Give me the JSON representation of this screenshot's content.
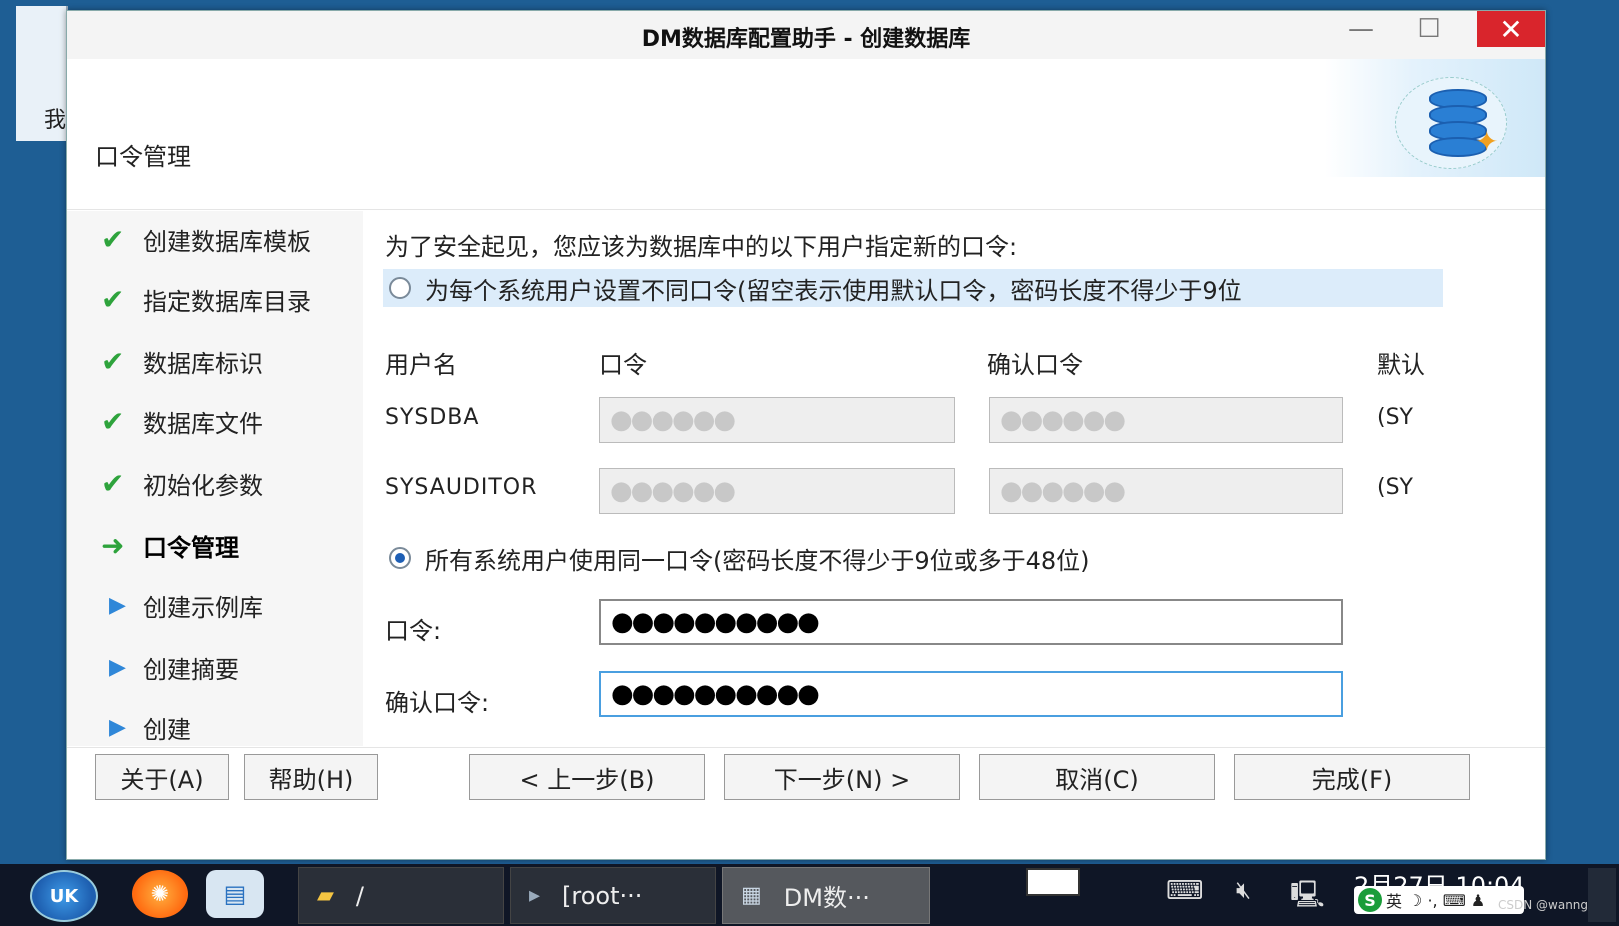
{
  "desktop": {
    "icon_text": "我"
  },
  "window": {
    "title": "DM数据库配置助手 - 创建数据库",
    "minimize": "—",
    "maximize": "☐",
    "close": "✕"
  },
  "header": {
    "section_title": "口令管理"
  },
  "nav": {
    "items": [
      {
        "label": "创建数据库模板",
        "status": "✔"
      },
      {
        "label": "指定数据库目录",
        "status": "✔"
      },
      {
        "label": "数据库标识",
        "status": "✔"
      },
      {
        "label": "数据库文件",
        "status": "✔"
      },
      {
        "label": "初始化参数",
        "status": "✔"
      },
      {
        "label": "口令管理",
        "status": "➜"
      },
      {
        "label": "创建示例库",
        "status": "▶"
      },
      {
        "label": "创建摘要",
        "status": "▶"
      },
      {
        "label": "创建",
        "status": "▶"
      }
    ]
  },
  "content": {
    "intro": "为了安全起见，您应该为数据库中的以下用户指定新的口令:",
    "option_individual": "为每个系统用户设置不同口令(留空表示使用默认口令，密码长度不得少于9位",
    "columns": {
      "username": "用户名",
      "password": "口令",
      "confirm": "确认口令",
      "default": "默认"
    },
    "users": [
      {
        "name": "SYSDBA",
        "password": "●●●●●●",
        "confirm": "●●●●●●",
        "default": "(SY"
      },
      {
        "name": "SYSAUDITOR",
        "password": "●●●●●●",
        "confirm": "●●●●●●",
        "default": "(SY"
      }
    ],
    "option_same": "所有系统用户使用同一口令(密码长度不得少于9位或多于48位)",
    "password_label": "口令:",
    "password_value": "●●●●●●●●●●",
    "confirm_label": "确认口令:",
    "confirm_value": "●●●●●●●●●●",
    "selected_option": "same"
  },
  "buttons": {
    "about": "关于(A)",
    "help": "帮助(H)",
    "prev": "< 上一步(B)",
    "next": "下一步(N) >",
    "cancel": "取消(C)",
    "finish": "完成(F)"
  },
  "taskbar": {
    "start": "UK",
    "tasks": [
      {
        "label": "/",
        "icon": "folder-icon"
      },
      {
        "label": "[root···",
        "icon": "terminal-icon"
      },
      {
        "label": "DM数···",
        "icon": "dm-icon"
      }
    ],
    "clock": "2月27日 10:04",
    "ime": {
      "logo": "S",
      "mode": "英"
    },
    "watermark": "CSDN @wanngshj"
  },
  "colors": {
    "accent": "#2ea33c",
    "close_red": "#d9252c",
    "highlight_row": "#dcecfa",
    "focus_border": "#4a9fe0"
  }
}
